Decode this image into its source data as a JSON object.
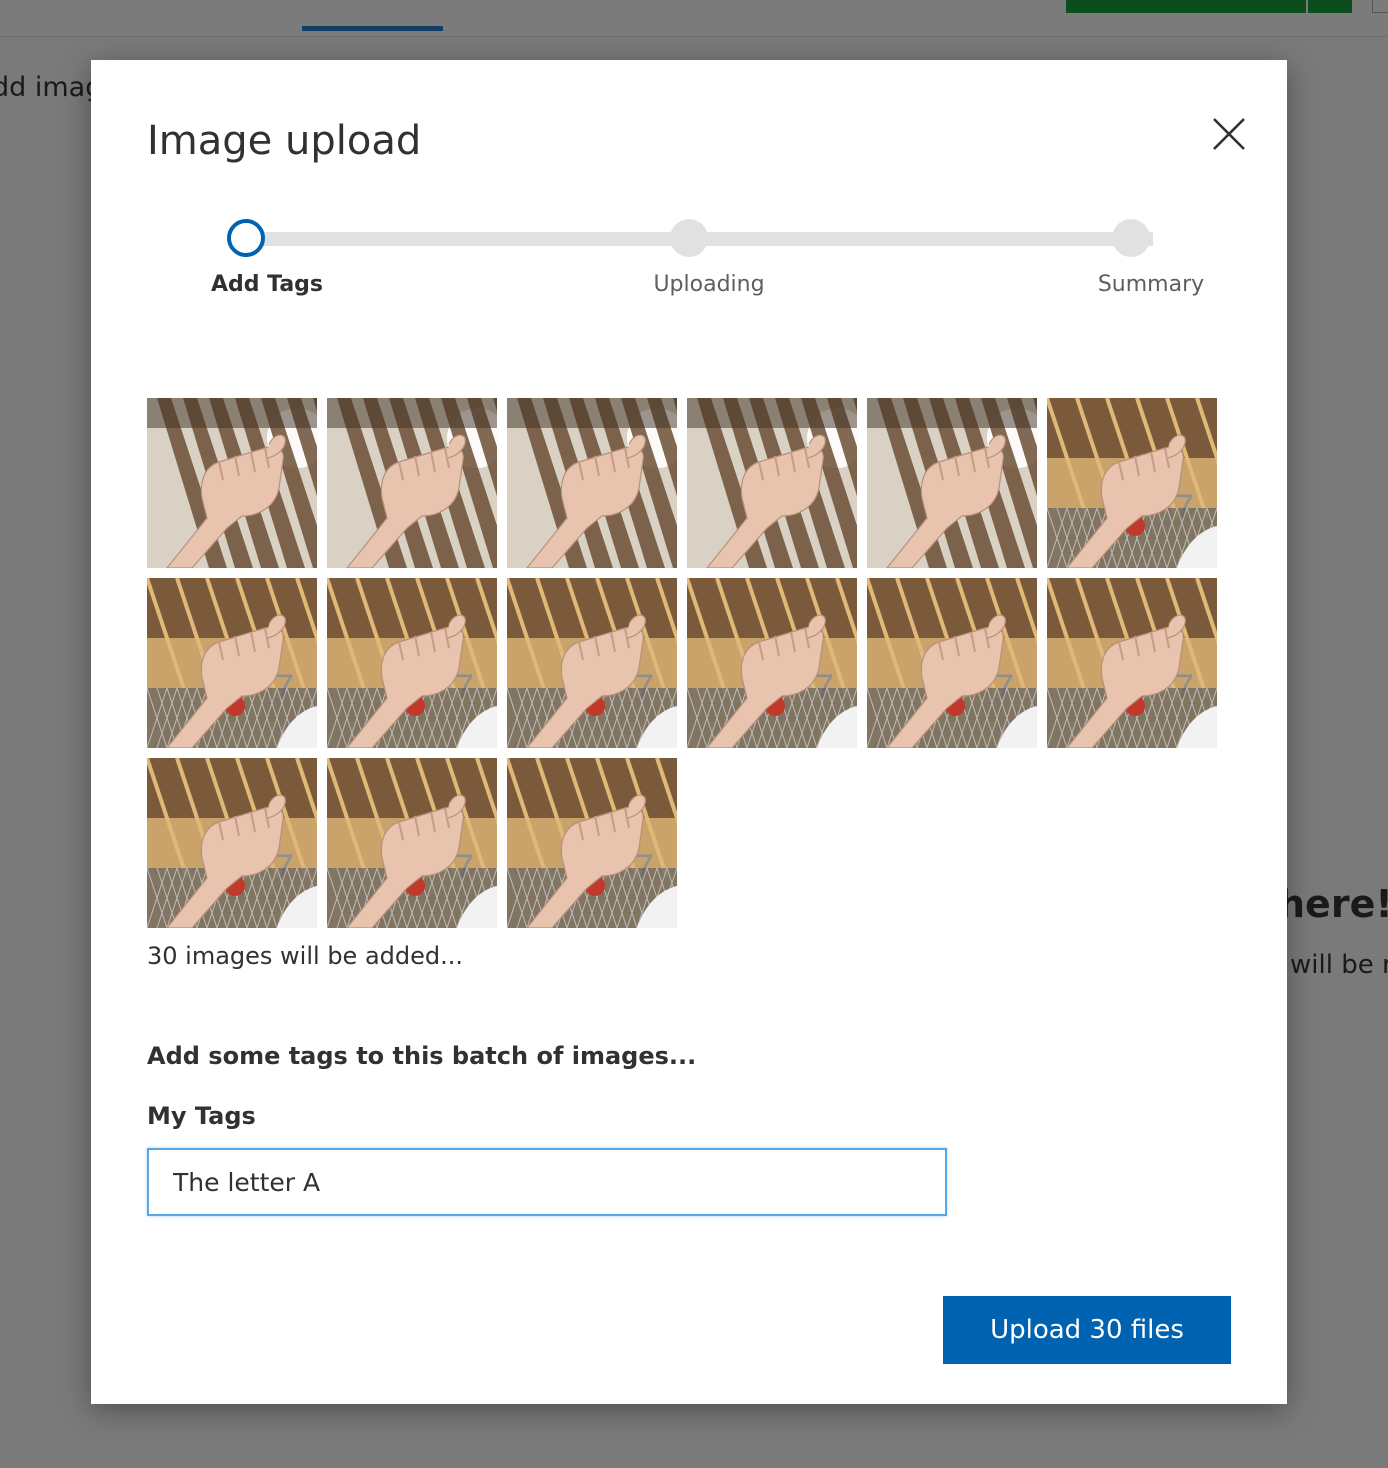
{
  "background": {
    "add_text": "dd imag",
    "heading_fragment": "here!",
    "body_fragment": "will be r"
  },
  "modal": {
    "title": "Image upload",
    "steps": [
      {
        "label": "Add Tags",
        "state": "active"
      },
      {
        "label": "Uploading",
        "state": "inactive"
      },
      {
        "label": "Summary",
        "state": "inactive"
      }
    ],
    "thumbnails": [
      {
        "scene": "wood-ceiling-bright"
      },
      {
        "scene": "wood-ceiling-bright"
      },
      {
        "scene": "wood-ceiling-bright"
      },
      {
        "scene": "wood-ceiling-bright"
      },
      {
        "scene": "wood-ceiling-bright"
      },
      {
        "scene": "building-fence"
      },
      {
        "scene": "building-fence"
      },
      {
        "scene": "building-fence"
      },
      {
        "scene": "building-fence"
      },
      {
        "scene": "building-fence"
      },
      {
        "scene": "building-fence"
      },
      {
        "scene": "building-fence"
      },
      {
        "scene": "building-fence"
      },
      {
        "scene": "building-fence"
      },
      {
        "scene": "building-fence"
      }
    ],
    "count_text": "30 images will be added...",
    "tags_heading": "Add some tags to this batch of images...",
    "tags_label": "My Tags",
    "tags_value": "The letter A",
    "upload_button_label": "Upload 30 files",
    "colors": {
      "accent": "#0063b1",
      "input_border": "#5aa7e6",
      "track": "#e1e1e1"
    }
  }
}
